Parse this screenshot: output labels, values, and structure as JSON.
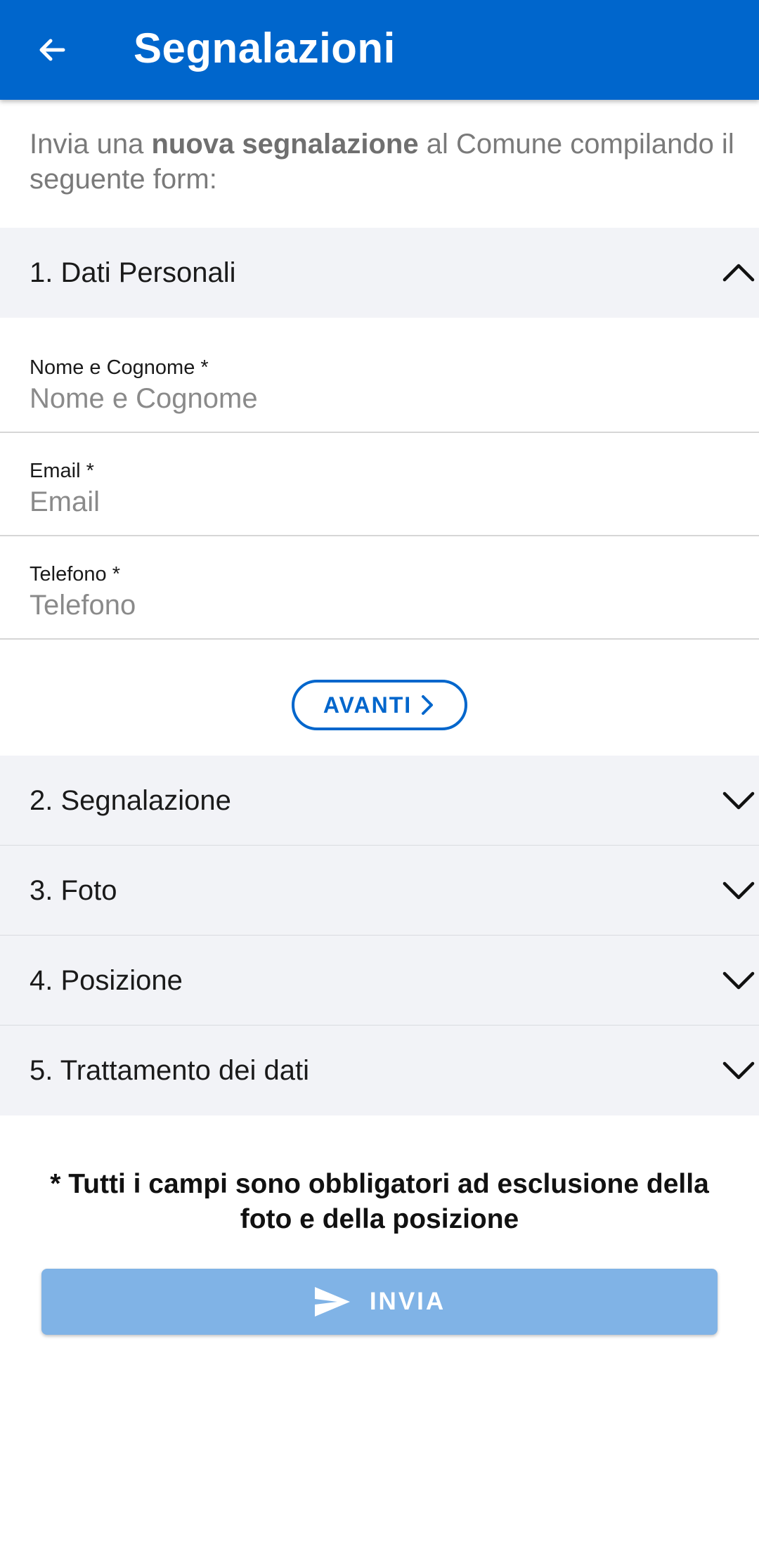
{
  "appbar": {
    "title": "Segnalazioni"
  },
  "intro": {
    "pre": "Invia una ",
    "bold": "nuova segnalazione",
    "post": " al Comune compilando il seguente form:"
  },
  "sections": [
    {
      "label": "1. Dati Personali",
      "expanded": true
    },
    {
      "label": "2. Segnalazione",
      "expanded": false
    },
    {
      "label": "3. Foto",
      "expanded": false
    },
    {
      "label": "4. Posizione",
      "expanded": false
    },
    {
      "label": "5. Trattamento dei dati",
      "expanded": false
    }
  ],
  "fields": {
    "nome": {
      "label": "Nome e Cognome *",
      "placeholder": "Nome e Cognome",
      "value": ""
    },
    "email": {
      "label": "Email *",
      "placeholder": "Email",
      "value": ""
    },
    "telefono": {
      "label": "Telefono *",
      "placeholder": "Telefono",
      "value": ""
    }
  },
  "avanti_label": "AVANTI",
  "note": "* Tutti i campi sono obbligatori ad esclusione della foto e della posizione",
  "invia_label": "INVIA",
  "colors": {
    "primary": "#0066cc",
    "section_bg": "#f2f3f7",
    "submit_disabled": "#80b3e6"
  },
  "icons": {
    "back": "arrow-left-icon",
    "collapse": "chevron-up-icon",
    "expand": "chevron-down-icon",
    "next": "chevron-right-icon",
    "send": "send-icon"
  }
}
